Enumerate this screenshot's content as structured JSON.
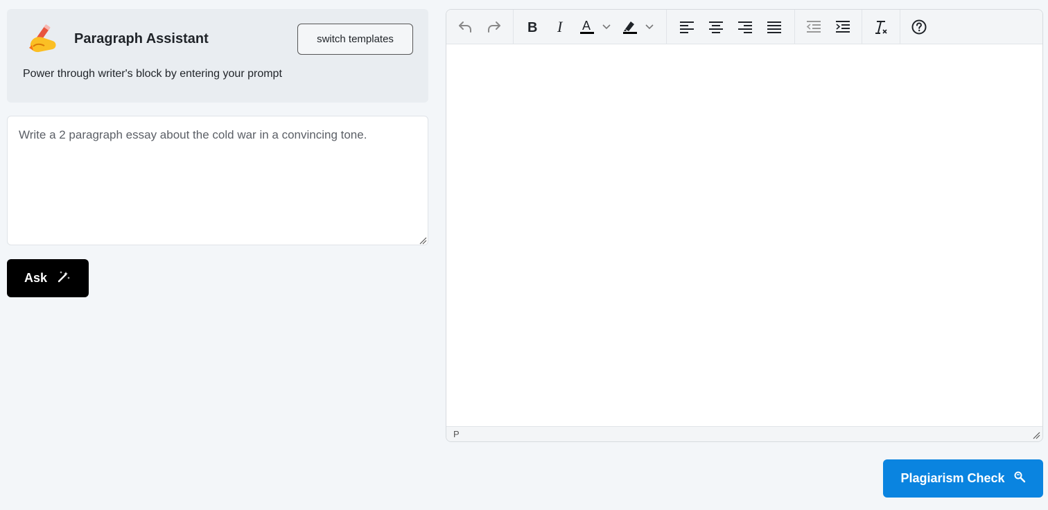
{
  "assistant": {
    "title": "Paragraph Assistant",
    "subtitle": "Power through writer's block by entering your prompt",
    "switch_label": "switch templates",
    "icon": "writing-hand-icon"
  },
  "prompt": {
    "value": "Write a 2 paragraph essay about the cold war in a convincing tone."
  },
  "ask_button": {
    "label": "Ask",
    "icon": "magic-wand-icon"
  },
  "editor": {
    "toolbar": [
      "undo-icon",
      "redo-icon",
      "bold-icon",
      "italic-icon",
      "text-color-icon",
      "highlight-color-icon",
      "align-left-icon",
      "align-center-icon",
      "align-right-icon",
      "justify-icon",
      "outdent-icon",
      "indent-icon",
      "clear-formatting-icon",
      "help-icon"
    ],
    "status_path": "P"
  },
  "plagiarism_button": {
    "label": "Plagiarism Check",
    "icon": "magnifier-icon"
  },
  "colors": {
    "primary": "#0a84e0",
    "ask_bg": "#000000",
    "page_bg": "#f3f6f9"
  }
}
